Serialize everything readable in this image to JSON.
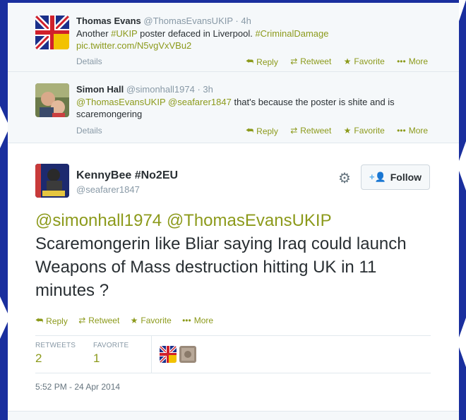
{
  "tweets": [
    {
      "name": "Thomas Evans",
      "handle": "@ThomasEvansUKIP",
      "time": "· 4h",
      "text_pre": "Another ",
      "hashtag1": "#UKIP",
      "text_mid": " poster defaced in Liverpool. ",
      "hashtag2": "#CriminalDamage",
      "link": "pic.twitter.com/N5vgVxVBu2",
      "details": "Details"
    },
    {
      "name": "Simon Hall",
      "handle": "@simonhall1974",
      "time": "· 3h",
      "mention1": "@ThomasEvansUKIP",
      "mention2": "@seafarer1847",
      "text": " that's because the poster is shite and is scaremongering",
      "details": "Details"
    }
  ],
  "actions": {
    "reply": "Reply",
    "retweet": "Retweet",
    "favorite": "Favorite",
    "more": "More"
  },
  "main": {
    "name": "KennyBee #No2EU",
    "handle": "@seafarer1847",
    "follow": "Follow",
    "mention1": "@simonhall1974",
    "mention2": "@ThomasEvansUKIP",
    "text": "Scaremongerin like Bliar saying Iraq could launch Weapons of Mass destruction hitting UK in 11 minutes ?",
    "retweets_label": "RETWEETS",
    "retweets_count": "2",
    "favorites_label": "FAVORITE",
    "favorites_count": "1",
    "timestamp": "5:52 PM - 24 Apr 2014"
  },
  "colors": {
    "link": "#8c9a1b",
    "background": "#1a2f9e"
  }
}
